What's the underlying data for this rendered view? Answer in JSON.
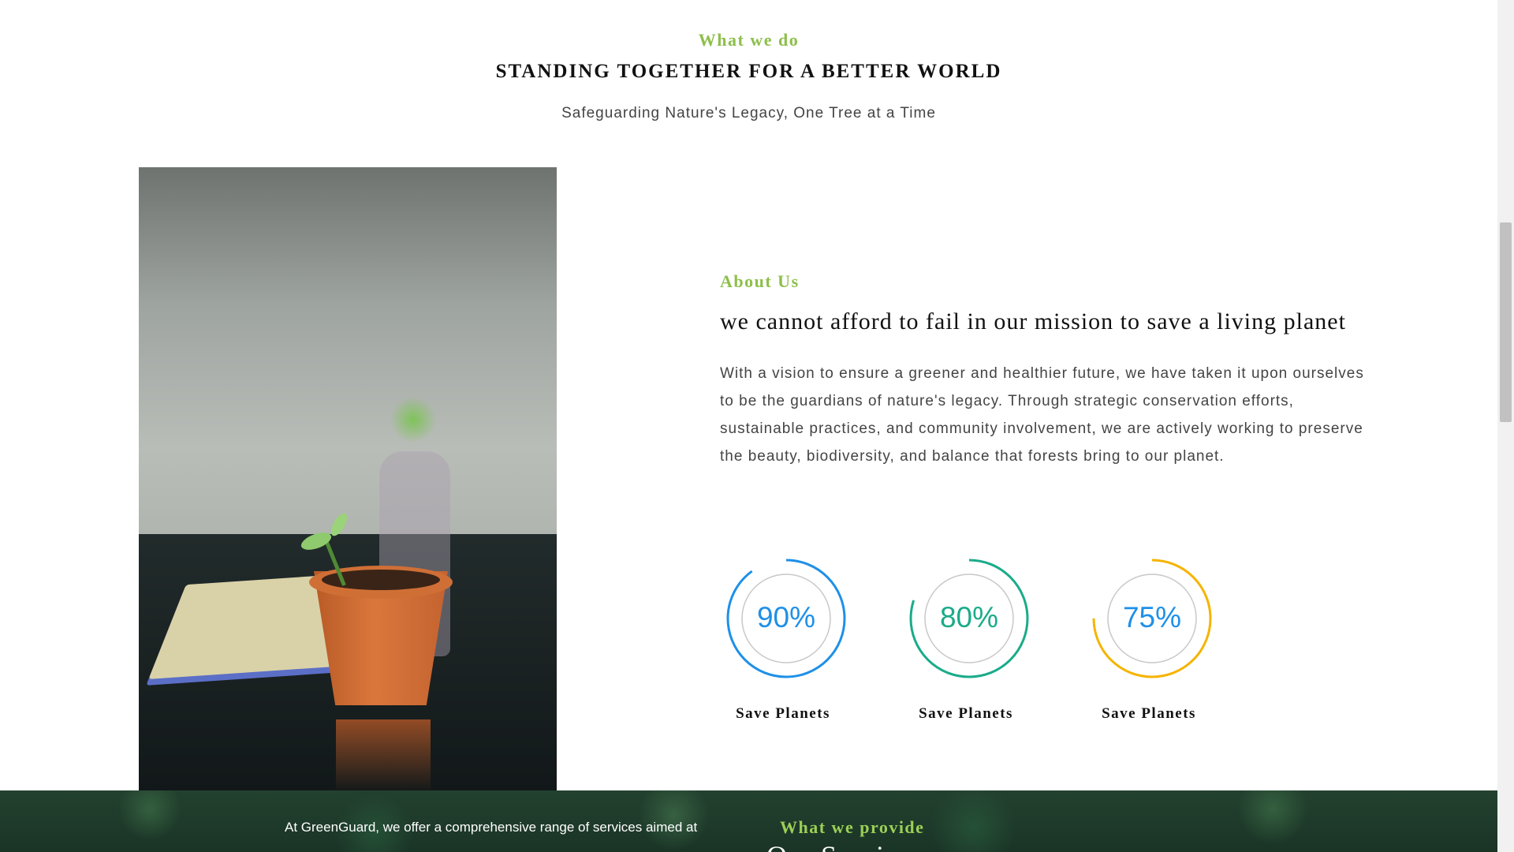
{
  "what_we_do": {
    "eyebrow": "What we do",
    "headline": "STANDING TOGETHER FOR A BETTER WORLD",
    "subline": "Safeguarding Nature's Legacy, One Tree at a Time"
  },
  "about": {
    "eyebrow": "About Us",
    "title": "we cannot afford to fail in our mission to save a living planet",
    "body": "With a vision to ensure a greener and healthier future, we have taken it upon ourselves to be the guardians of nature's legacy. Through strategic conservation efforts, sustainable practices, and community involvement, we are actively working to preserve the beauty, biodiversity, and balance that forests bring to our planet."
  },
  "stats": [
    {
      "value": "90%",
      "percent": 90,
      "label": "Save Planets",
      "color": "#1e90e8"
    },
    {
      "value": "80%",
      "percent": 80,
      "label": "Save Planets",
      "color": "#1aab8a"
    },
    {
      "value": "75%",
      "percent": 75,
      "label": "Save Planets",
      "color": "#f5b400"
    }
  ],
  "services": {
    "text": "At GreenGuard, we offer a comprehensive range of services aimed at",
    "eyebrow": "What we provide",
    "title": "Our Services"
  },
  "colors": {
    "accent_green": "#8dbf4b",
    "stat_value": "#1e90e8"
  }
}
